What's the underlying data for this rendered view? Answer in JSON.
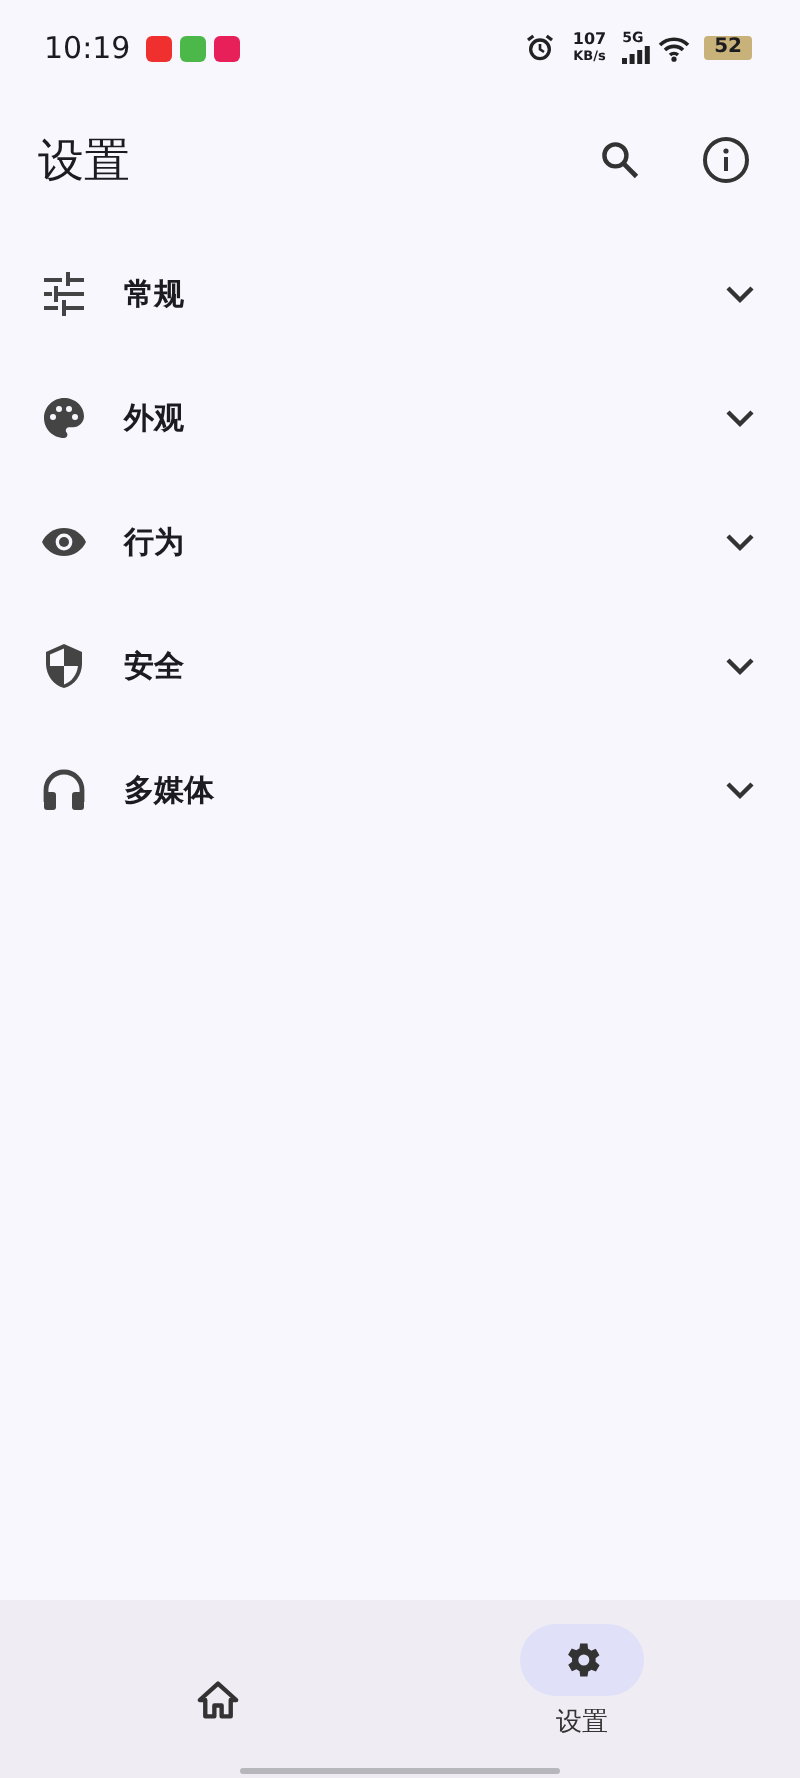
{
  "status_bar": {
    "time": "10:19",
    "notifications": [
      {
        "kind": "red"
      },
      {
        "kind": "green"
      },
      {
        "kind": "pink"
      }
    ],
    "speed": "107",
    "speed_unit": "KB/s",
    "network": "5G",
    "battery": "52"
  },
  "app_bar": {
    "title": "设置"
  },
  "sections": [
    {
      "kind": "tune",
      "label": "常规",
      "expanded": false
    },
    {
      "kind": "palette",
      "label": "外观",
      "expanded": false
    },
    {
      "kind": "eye",
      "label": "行为",
      "expanded": false
    },
    {
      "kind": "shield",
      "label": "安全",
      "expanded": false
    },
    {
      "kind": "headphones",
      "label": "多媒体",
      "expanded": false
    }
  ],
  "bottom_nav": [
    {
      "kind": "home",
      "selected": false
    },
    {
      "kind": "settings",
      "label": "设置",
      "selected": true
    }
  ]
}
